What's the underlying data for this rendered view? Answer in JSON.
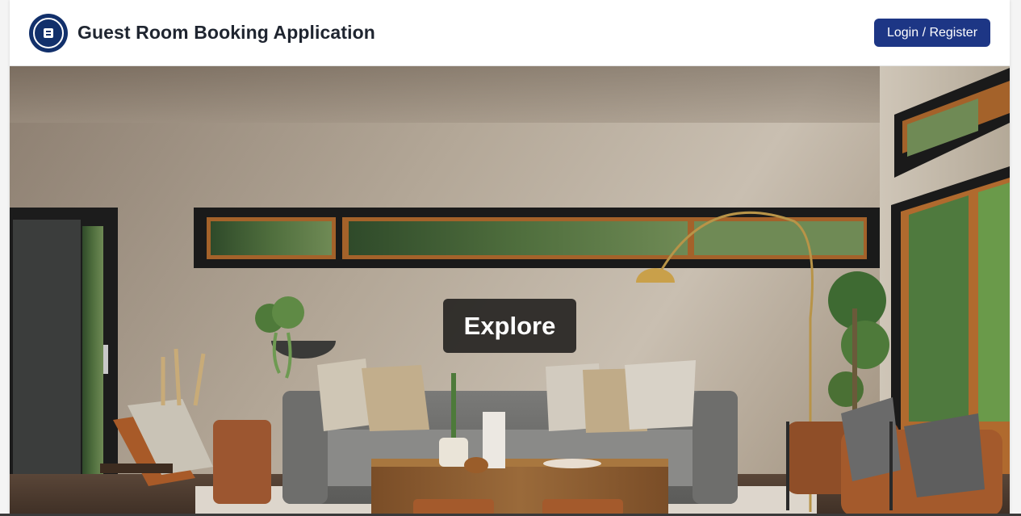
{
  "header": {
    "app_title": "Guest Room Booking Application",
    "login_label": "Login / Register",
    "logo_icon": "booking-logo-icon"
  },
  "hero": {
    "explore_label": "Explore",
    "image_subject": "living-room-photo"
  },
  "colors": {
    "brand_navy": "#12306b",
    "button_blue": "#1d3685",
    "title_text": "#1f2530",
    "explore_bg": "#282624"
  }
}
